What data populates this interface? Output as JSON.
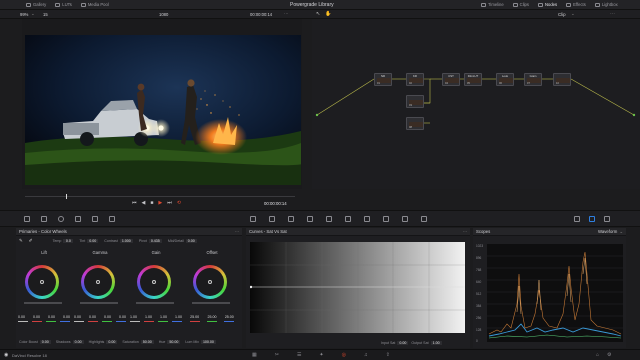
{
  "topbar": {
    "tabs": [
      "Gallery",
      "LUTs",
      "Media Pool"
    ],
    "title": "Powergrade Library",
    "right_tabs": [
      "Timeline",
      "Clips",
      "Nodes",
      "Effects",
      "Lightbox"
    ]
  },
  "bar2": {
    "zoom": "99%",
    "version": "15",
    "res": "1080",
    "timecode": "00:00:00:14",
    "clip": "Clip"
  },
  "viewer": {
    "timecode": "00:00:00:14"
  },
  "nodes": [
    {
      "label": "NR",
      "num": "01"
    },
    {
      "label": "KR",
      "num": "02"
    },
    {
      "label": "",
      "num": "03"
    },
    {
      "label": "CST",
      "num": "04"
    },
    {
      "label": "FilmLUT",
      "num": "05"
    },
    {
      "label": "Look",
      "num": "06"
    },
    {
      "label": "Grain",
      "num": "07"
    },
    {
      "label": "",
      "num": "08"
    },
    {
      "label": "",
      "num": "09"
    },
    {
      "label": "",
      "num": "10"
    }
  ],
  "primaries": {
    "title": "Primaries - Color Wheels",
    "params_top": [
      {
        "label": "Temp",
        "value": "0.0"
      },
      {
        "label": "Tint",
        "value": "0.00"
      },
      {
        "label": "Contrast",
        "value": "1.000"
      },
      {
        "label": "Pivot",
        "value": "0.435"
      },
      {
        "label": "Mid/Detail",
        "value": "0.00"
      }
    ],
    "wheels": [
      {
        "name": "Lift",
        "values": [
          "0.00",
          "0.00",
          "0.00",
          "0.00"
        ]
      },
      {
        "name": "Gamma",
        "values": [
          "0.00",
          "0.00",
          "0.00",
          "0.00"
        ]
      },
      {
        "name": "Gain",
        "values": [
          "1.00",
          "1.00",
          "1.00",
          "1.00"
        ]
      },
      {
        "name": "Offset",
        "values": [
          "25.00",
          "25.00",
          "25.00"
        ]
      }
    ],
    "params_bottom": [
      {
        "label": "Color Boost",
        "value": "0.00"
      },
      {
        "label": "Shadows",
        "value": "0.00"
      },
      {
        "label": "Highlights",
        "value": "0.00"
      },
      {
        "label": "Saturation",
        "value": "50.00"
      },
      {
        "label": "Hue",
        "value": "50.00"
      },
      {
        "label": "Lum Mix",
        "value": "100.00"
      }
    ]
  },
  "curves": {
    "title": "Curves - Sat Vs Sat",
    "input_label": "Input Sat",
    "input_value": "0.00",
    "output_label": "Output Sat",
    "output_value": "1.00"
  },
  "scopes": {
    "title": "Scopes",
    "mode": "Waveform",
    "labels": [
      "1023",
      "896",
      "768",
      "640",
      "512",
      "384",
      "256",
      "128",
      "0"
    ]
  },
  "bottom": {
    "app": "DaVinci Resolve 18"
  },
  "colors": {
    "accent": "#e0492f",
    "bg": "#1c1c1e",
    "blue": "#2f7fe0"
  }
}
